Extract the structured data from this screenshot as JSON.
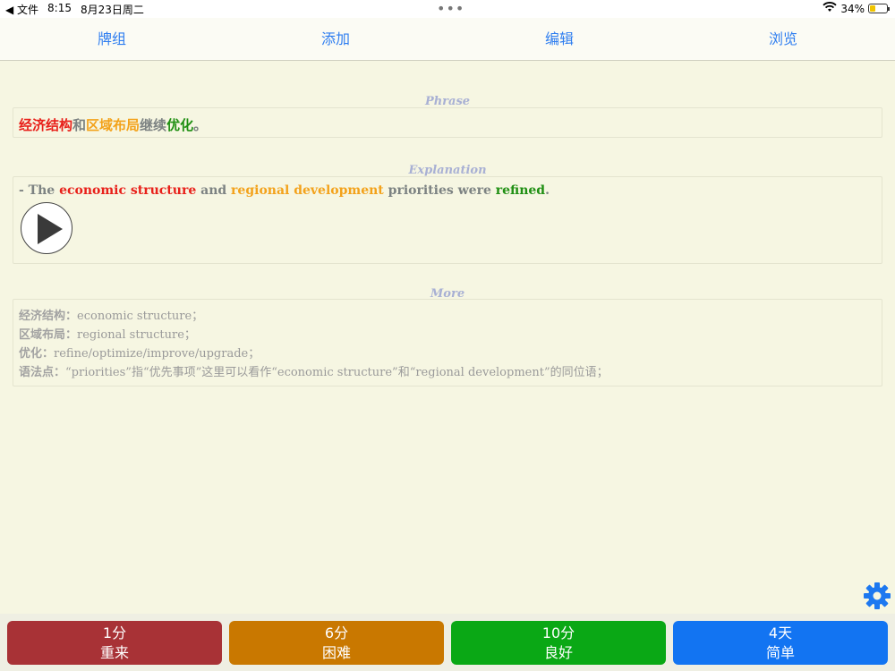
{
  "status_bar": {
    "back_app": "◀ 文件",
    "time": "8:15",
    "date": "8月23日周二",
    "dots": "•••",
    "battery_percent": "34%",
    "battery_level": 0.34
  },
  "toolbar": {
    "tabs": [
      {
        "label": "牌组"
      },
      {
        "label": "添加"
      },
      {
        "label": "编辑"
      },
      {
        "label": "浏览"
      }
    ]
  },
  "card": {
    "phrase_label": "Phrase",
    "phrase_segments": [
      {
        "text": "经济结构",
        "color": "#e8201a"
      },
      {
        "text": "和",
        "color": "#7c8282"
      },
      {
        "text": "区域布局",
        "color": "#f3a21b"
      },
      {
        "text": "继续",
        "color": "#7c8282"
      },
      {
        "text": "优化",
        "color": "#1f8f12"
      },
      {
        "text": "。",
        "color": "#7c8282"
      }
    ],
    "explanation_label": "Explanation",
    "explanation_segments": [
      {
        "text": "- The ",
        "color": "#7c8282"
      },
      {
        "text": "economic structure",
        "color": "#e8201a"
      },
      {
        "text": " and ",
        "color": "#7c8282"
      },
      {
        "text": "regional development",
        "color": "#f3a21b"
      },
      {
        "text": " priorities were ",
        "color": "#7c8282"
      },
      {
        "text": "refined",
        "color": "#1f8f12"
      },
      {
        "text": ".",
        "color": "#7c8282"
      }
    ],
    "more_label": "More",
    "more_rows": [
      {
        "key": "经济结构：",
        "value": "economic structure；"
      },
      {
        "key": "区域布局：",
        "value": "regional structure；"
      },
      {
        "key": "优化：",
        "value": "refine/optimize/improve/upgrade；"
      },
      {
        "key": "语法点：",
        "value": "“priorities”指“优先事项”这里可以看作“economic structure”和“regional development”的同位语；"
      }
    ]
  },
  "icons": {
    "play": "play-icon",
    "settings": "gear-icon",
    "wifi": "wifi-icon",
    "battery": "battery-icon"
  },
  "grade_buttons": [
    {
      "interval": "1分",
      "label": "重来",
      "color": "#a83236"
    },
    {
      "interval": "6分",
      "label": "困难",
      "color": "#c97800"
    },
    {
      "interval": "10分",
      "label": "良好",
      "color": "#0aa815"
    },
    {
      "interval": "4天",
      "label": "简单",
      "color": "#1274f2"
    }
  ],
  "colors": {
    "background": "#f6f6e2",
    "accent": "#2f7ef0",
    "section_label": "#a8b0d4"
  }
}
